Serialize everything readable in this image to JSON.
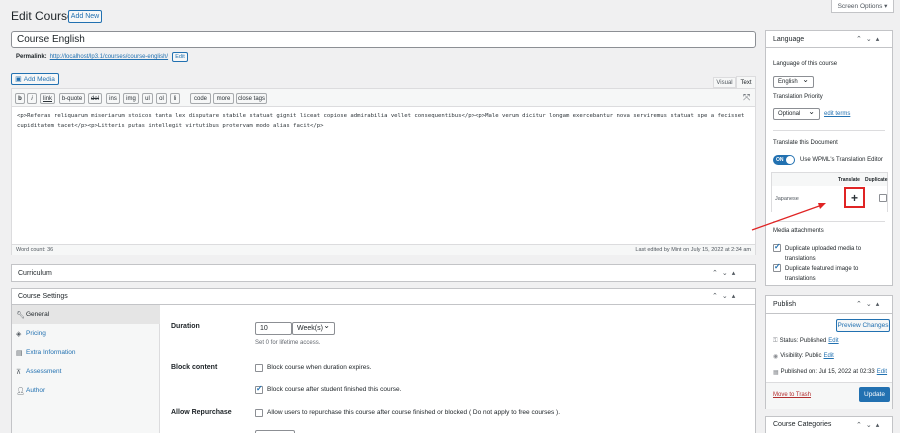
{
  "header": {
    "title": "Edit Course",
    "add_new": "Add New",
    "screen_options": "Screen Options ▾"
  },
  "post": {
    "title": "Course English",
    "permalink_label": "Permalink:",
    "permalink_url": "http://localhost/lp3.1/courses/course-english/",
    "edit_btn": "Edit"
  },
  "editor": {
    "add_media": "Add Media",
    "tab_visual": "Visual",
    "tab_text": "Text",
    "quicktags": [
      "b",
      "i",
      "link",
      "b-quote",
      "del",
      "ins",
      "img",
      "ul",
      "ol",
      "li",
      "code",
      "more",
      "close tags"
    ],
    "content": "<p>Referas reliquarum miseriarum stoicos tanta lex disputare stabile statuat gignit liceat copiose admirabilia vellet consequentibus</p><p>Male verum dicitur longam exercebantur nova serviremus statuat spe a fecisset cupiditatem tacet</p><p>Litteris putas intellegit virtutibus protervam modo alias facit</p>",
    "word_count": "Word count: 36",
    "last_edited": "Last edited by Mint on July 15, 2022 at 2:34 am"
  },
  "curriculum": {
    "title": "Curriculum"
  },
  "settings": {
    "title": "Course Settings",
    "tabs": [
      {
        "label": "General",
        "icon": "wrench-icon"
      },
      {
        "label": "Pricing",
        "icon": "tag-icon"
      },
      {
        "label": "Extra Information",
        "icon": "list-icon"
      },
      {
        "label": "Assessment",
        "icon": "pin-icon"
      },
      {
        "label": "Author",
        "icon": "user-icon"
      }
    ],
    "duration_label": "Duration",
    "duration_value": "10",
    "duration_unit": "Week(s)",
    "duration_hint": "Set 0 for lifetime access.",
    "block_label": "Block content",
    "block_opt1": "Block course when duration expires.",
    "block_opt2": "Block course after student finished this course.",
    "repurchase_label": "Allow Repurchase",
    "repurchase_opt": "Allow users to repurchase this course after course finished or blocked ( Do not apply to free courses )."
  },
  "language": {
    "title": "Language",
    "lang_of_course": "Language of this course",
    "lang_value": "English",
    "priority_label": "Translation Priority",
    "priority_value": "Optional",
    "edit_terms": "edit terms",
    "translate_doc": "Translate this Document",
    "toggle_label": "Use WPML's Translation Editor",
    "toggle_state": "ON",
    "col_translate": "Translate",
    "col_duplicate": "Duplicate",
    "row_lang": "Japanese",
    "media_title": "Media attachments",
    "media_opt1": "Duplicate uploaded media to translations",
    "media_opt2": "Duplicate featured image to translations"
  },
  "publish": {
    "title": "Publish",
    "preview": "Preview Changes",
    "status": "Status: Published",
    "status_edit": "Edit",
    "visibility": "Visibility: Public",
    "visibility_edit": "Edit",
    "published_on": "Published on: Jul 15, 2022 at 02:33",
    "published_edit": "Edit",
    "trash": "Move to Trash",
    "update": "Update"
  },
  "categories": {
    "title": "Course Categories"
  },
  "colors": {
    "accent": "#2271b1",
    "highlight": "#e02424"
  }
}
